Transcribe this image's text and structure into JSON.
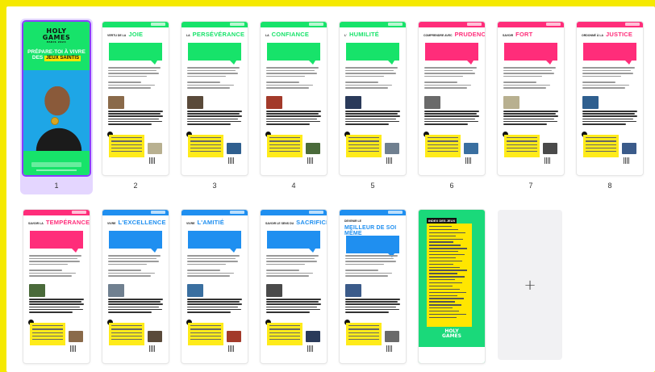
{
  "accent": "#8b3dff",
  "colors": {
    "green": "#17e36a",
    "pink": "#ff2d7a",
    "blue": "#1f8ff0",
    "yellow": "#ffeb1a"
  },
  "pages": [
    {
      "num": "1",
      "kind": "cover",
      "logo_line1": "HOLY",
      "logo_line2": "GAMES",
      "logo_sub": "PARIS 2024",
      "headline": "PRÉPARE-TOI À VIVRE",
      "headline_prefix": "DES",
      "headline_highlight": "JEUX SAINTIS"
    },
    {
      "num": "2",
      "kind": "virtue",
      "color": "green",
      "small": "VERTU DE LA",
      "title": "JOIE"
    },
    {
      "num": "3",
      "kind": "virtue",
      "color": "green",
      "small": "LA",
      "title": "PERSÉVÉRANCE"
    },
    {
      "num": "4",
      "kind": "virtue",
      "color": "green",
      "small": "LA",
      "title": "CONFIANCE"
    },
    {
      "num": "5",
      "kind": "virtue",
      "color": "green",
      "small": "L'",
      "title": "HUMILITÉ"
    },
    {
      "num": "6",
      "kind": "virtue",
      "color": "pink",
      "small": "COMPRENDRE AVEC",
      "title": "PRUDENCE"
    },
    {
      "num": "7",
      "kind": "virtue",
      "color": "pink",
      "small": "SAVOIR",
      "title": "FORT"
    },
    {
      "num": "8",
      "kind": "virtue",
      "color": "pink",
      "small": "ORDONNÉ À LA",
      "title": "JUSTICE"
    },
    {
      "num": "",
      "kind": "virtue",
      "color": "pink",
      "small": "SAVOIR LA",
      "title": "TEMPÉRANCE"
    },
    {
      "num": "",
      "kind": "virtue",
      "color": "blue",
      "small": "VIVRE",
      "title": "L'EXCELLENCE"
    },
    {
      "num": "",
      "kind": "virtue",
      "color": "blue",
      "small": "VIVRE",
      "title": "L'AMITIÉ"
    },
    {
      "num": "",
      "kind": "virtue",
      "color": "blue",
      "small": "SAVOIR LE SENS DU",
      "title": "SACRIFICE"
    },
    {
      "num": "",
      "kind": "virtue",
      "color": "blue",
      "small": "DEVENIR LE",
      "title": "MEILLEUR DE SOI MÊME"
    },
    {
      "num": "",
      "kind": "index",
      "title": "INDEX DES JEUX",
      "logo_line1": "HOLY",
      "logo_line2": "GAMES"
    }
  ],
  "add_page": {
    "symbol": "+"
  }
}
